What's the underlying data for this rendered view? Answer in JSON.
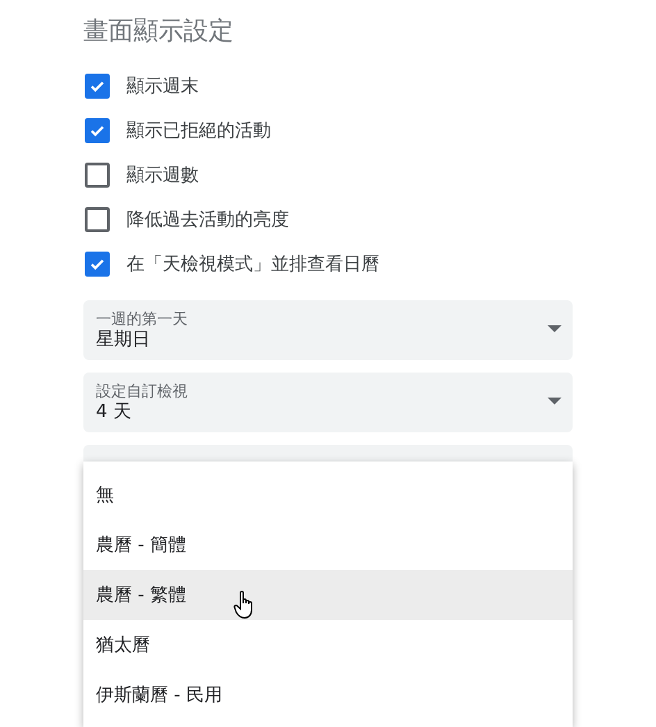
{
  "section_title": "畫面顯示設定",
  "options": [
    {
      "label": "顯示週末",
      "checked": true
    },
    {
      "label": "顯示已拒絕的活動",
      "checked": true
    },
    {
      "label": "顯示週數",
      "checked": false
    },
    {
      "label": "降低過去活動的亮度",
      "checked": false
    },
    {
      "label": "在「天檢視模式」並排查看日曆",
      "checked": true
    }
  ],
  "selects": [
    {
      "label": "一週的第一天",
      "value": "星期日"
    },
    {
      "label": "設定自訂檢視",
      "value": "4 天"
    }
  ],
  "menu": [
    {
      "label": "無",
      "highlighted": false
    },
    {
      "label": "農曆 - 簡體",
      "highlighted": false
    },
    {
      "label": "農曆 - 繁體",
      "highlighted": true
    },
    {
      "label": "猶太曆",
      "highlighted": false
    },
    {
      "label": "伊斯蘭曆 - 民用",
      "highlighted": false
    }
  ]
}
